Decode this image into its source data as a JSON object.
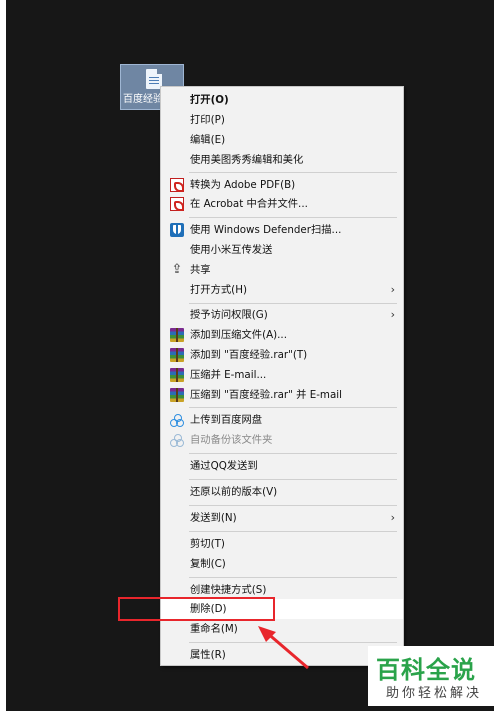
{
  "desktop": {
    "file": {
      "caption": "百度经验",
      "icon": "document-icon"
    }
  },
  "menu": {
    "open": "打开(O)",
    "print": "打印(P)",
    "edit": "编辑(E)",
    "meitu": "使用美图秀秀编辑和美化",
    "to_pdf": "转换为 Adobe PDF(B)",
    "acrobat_merge": "在 Acrobat 中合并文件...",
    "defender": "使用 Windows Defender扫描...",
    "xiaomi": "使用小米互传发送",
    "share": "共享",
    "open_with": "打开方式(H)",
    "grant_access": "授予访问权限(G)",
    "add_archive": "添加到压缩文件(A)...",
    "add_rar": "添加到 \"百度经验.rar\"(T)",
    "compress_email": "压缩并 E-mail...",
    "compress_rar_email": "压缩到 \"百度经验.rar\" 并 E-mail",
    "upload_baidu": "上传到百度网盘",
    "auto_backup": "自动备份该文件夹",
    "qq_send": "通过QQ发送到",
    "restore": "还原以前的版本(V)",
    "send_to": "发送到(N)",
    "cut": "剪切(T)",
    "copy": "复制(C)",
    "shortcut": "创建快捷方式(S)",
    "delete": "删除(D)",
    "rename": "重命名(M)",
    "properties": "属性(R)",
    "submenu_arrow": "›"
  },
  "annotation": {
    "highlight_color": "#e8262c",
    "target": "delete"
  },
  "watermark": {
    "title": "百科全说",
    "subtitle": "助你轻松解决",
    "color": "#2aa34a"
  }
}
